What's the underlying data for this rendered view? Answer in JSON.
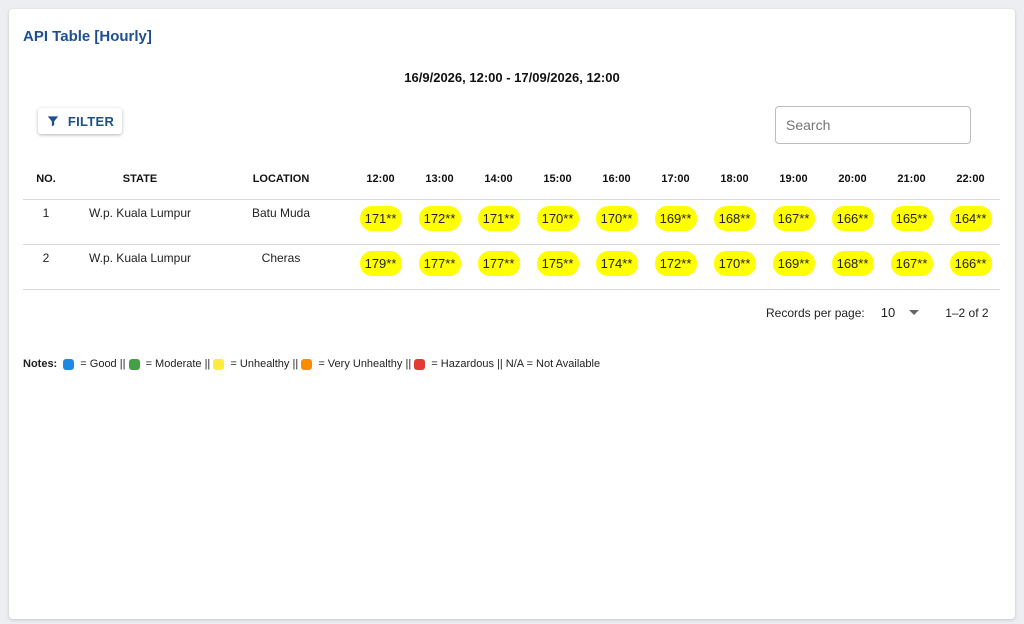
{
  "title": "API Table [Hourly]",
  "date_range": "16/9/2026, 12:00 - 17/09/2026, 12:00",
  "filter_label": "FILTER",
  "search_placeholder": "Search",
  "columns": {
    "no": "NO.",
    "state": "STATE",
    "location": "LOCATION",
    "hours": [
      "12:00",
      "13:00",
      "14:00",
      "15:00",
      "16:00",
      "17:00",
      "18:00",
      "19:00",
      "20:00",
      "21:00",
      "22:00"
    ]
  },
  "rows": [
    {
      "no": "1",
      "state": "W.p. Kuala Lumpur",
      "location": "Batu Muda",
      "values": [
        "171**",
        "172**",
        "171**",
        "170**",
        "170**",
        "169**",
        "168**",
        "167**",
        "166**",
        "165**",
        "164**"
      ]
    },
    {
      "no": "2",
      "state": "W.p. Kuala Lumpur",
      "location": "Cheras",
      "values": [
        "179**",
        "177**",
        "177**",
        "175**",
        "174**",
        "172**",
        "170**",
        "169**",
        "168**",
        "167**",
        "166**"
      ]
    }
  ],
  "pagination": {
    "records_label": "Records per page:",
    "records_value": "10",
    "range": "1–2 of 2"
  },
  "notes": {
    "label": "Notes:",
    "legend": [
      {
        "color": "#1e88e5",
        "text": " = Good || "
      },
      {
        "color": "#43a047",
        "text": " = Moderate || "
      },
      {
        "color": "#ffeb3b",
        "text": " = Unhealthy || "
      },
      {
        "color": "#fb8c00",
        "text": " = Very Unhealthy || "
      },
      {
        "color": "#e53935",
        "text": " = Hazardous || N/A = Not Available"
      }
    ]
  },
  "colors": {
    "accent": "#1d4f91",
    "unhealthy_pill": "#ffff00"
  }
}
